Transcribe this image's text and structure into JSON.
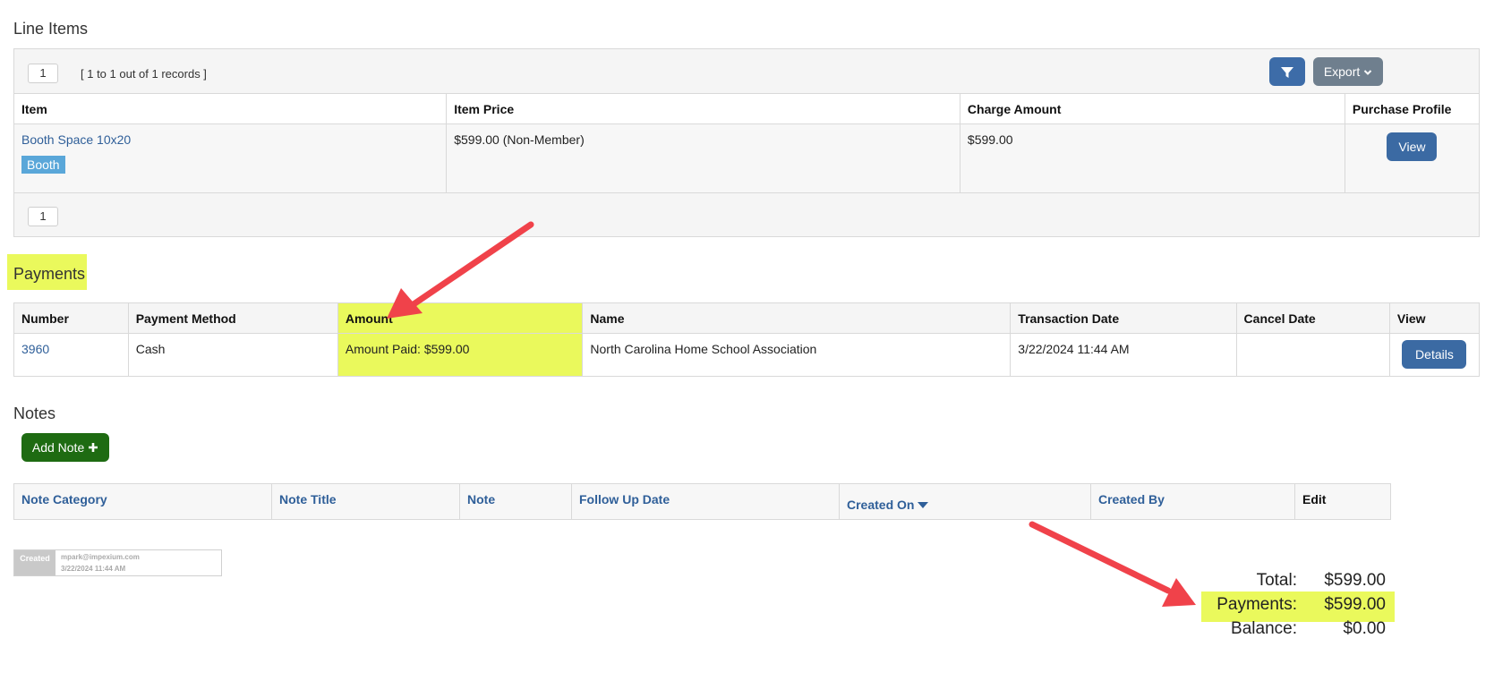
{
  "line_items": {
    "title": "Line Items",
    "page_number": "1",
    "records_text": "[ 1 to 1 out of 1 records ]",
    "export_label": "Export",
    "columns": [
      "Item",
      "Item Price",
      "Charge Amount",
      "Purchase Profile"
    ],
    "row": {
      "item_name": "Booth Space 10x20",
      "item_tag": "Booth",
      "item_price": "$599.00 (Non-Member)",
      "charge_amount": "$599.00",
      "view_label": "View"
    },
    "footer_page": "1"
  },
  "payments": {
    "title": "Payments",
    "columns": [
      "Number",
      "Payment Method",
      "Amount",
      "Name",
      "Transaction Date",
      "Cancel Date",
      "View"
    ],
    "row": {
      "number": "3960",
      "method": "Cash",
      "amount": "Amount Paid: $599.00",
      "name": "North Carolina Home School Association",
      "transaction_date": "3/22/2024 11:44 AM",
      "cancel_date": "",
      "details_label": "Details"
    }
  },
  "notes": {
    "title": "Notes",
    "add_note_label": "Add Note",
    "columns": [
      "Note Category",
      "Note Title",
      "Note",
      "Follow Up Date",
      "Created On",
      "Created By",
      "Edit"
    ]
  },
  "created_stamp": {
    "label": "Created",
    "user": "mpark@impexium.com",
    "date": "3/22/2024 11:44 AM"
  },
  "totals": {
    "total_label": "Total:",
    "total_value": "$599.00",
    "payments_label": "Payments:",
    "payments_value": "$599.00",
    "balance_label": "Balance:",
    "balance_value": "$0.00"
  },
  "colors": {
    "highlight": "#eaf95c",
    "arrow": "#f0424a",
    "primary_button": "#3b6aa3",
    "add_note_button": "#1e6b12",
    "tag": "#5aa7d9"
  }
}
